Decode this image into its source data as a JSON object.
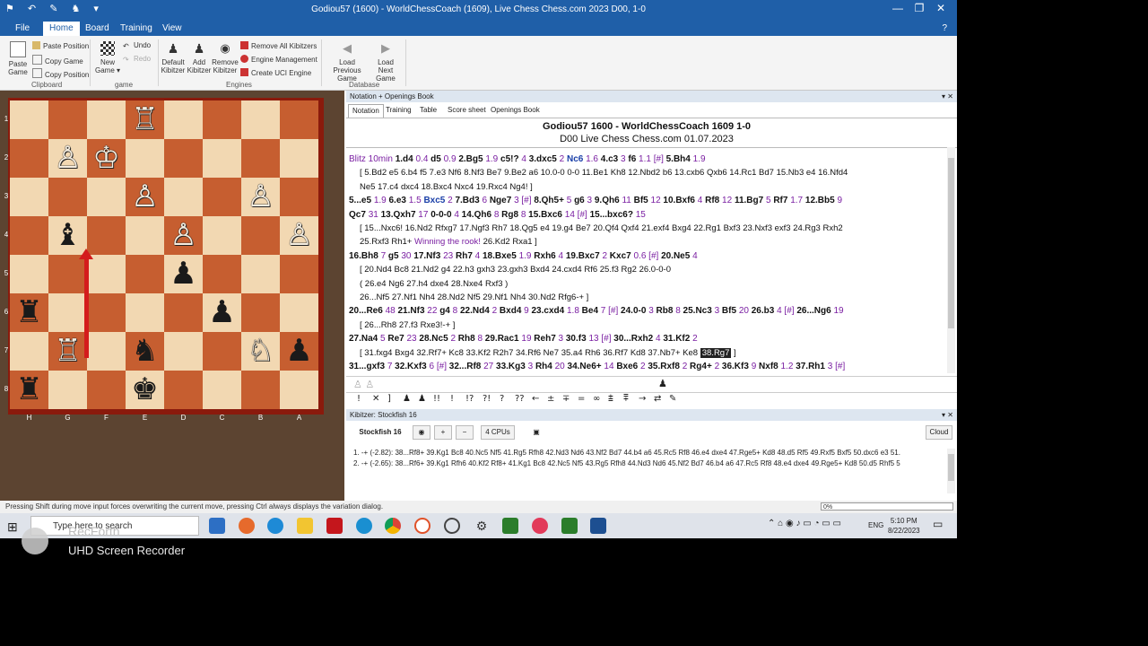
{
  "window": {
    "title": "Godiou57 (1600) - WorldChessCoach (1609), Live Chess Chess.com 2023  D00, 1-0",
    "controls": [
      "—",
      "❐",
      "✕"
    ]
  },
  "ribbon": {
    "tabs": [
      "File",
      "Home",
      "Board",
      "Training",
      "View"
    ],
    "active_tab": "Home",
    "clipboard": {
      "paste_game": "Paste Game",
      "paste_position": "Paste Position",
      "copy_game": "Copy Game",
      "copy_position": "Copy Position",
      "group": "Clipboard"
    },
    "game": {
      "new_game": "New Game ▾",
      "undo": "Undo",
      "redo": "Redo",
      "group": "game"
    },
    "engines": {
      "default_kibitzer": "Default Kibitzer",
      "add_kibitzer": "Add Kibitzer",
      "remove_kibitzer": "Remove Kibitzer",
      "remove_all": "Remove All Kibitzers",
      "engine_mgmt": "Engine Management",
      "create_uci": "Create UCI Engine",
      "group": "Engines"
    },
    "database": {
      "load_prev": "Load Previous Game",
      "load_next": "Load Next Game",
      "group": "Database"
    }
  },
  "board": {
    "ranks": [
      "1",
      "2",
      "3",
      "4",
      "5",
      "6",
      "7",
      "8"
    ],
    "files": [
      "H",
      "G",
      "F",
      "E",
      "D",
      "C",
      "B",
      "A"
    ],
    "pieces": [
      {
        "sq": "e1",
        "glyph": "♖",
        "color": "w"
      },
      {
        "sq": "g2",
        "glyph": "♙",
        "color": "w"
      },
      {
        "sq": "f2",
        "glyph": "♔",
        "color": "w"
      },
      {
        "sq": "e3",
        "glyph": "♙",
        "color": "w"
      },
      {
        "sq": "b3",
        "glyph": "♙",
        "color": "w"
      },
      {
        "sq": "g4",
        "glyph": "♝",
        "color": "b"
      },
      {
        "sq": "d4",
        "glyph": "♙",
        "color": "w"
      },
      {
        "sq": "a4",
        "glyph": "♙",
        "color": "w"
      },
      {
        "sq": "d5",
        "glyph": "♟",
        "color": "b"
      },
      {
        "sq": "h6",
        "glyph": "♜",
        "color": "b"
      },
      {
        "sq": "c6",
        "glyph": "♟",
        "color": "b"
      },
      {
        "sq": "g7",
        "glyph": "♖",
        "color": "w"
      },
      {
        "sq": "e7",
        "glyph": "♞",
        "color": "b"
      },
      {
        "sq": "b7",
        "glyph": "♘",
        "color": "w"
      },
      {
        "sq": "a7",
        "glyph": "♟",
        "color": "b"
      },
      {
        "sq": "h8",
        "glyph": "♜",
        "color": "b"
      },
      {
        "sq": "e8",
        "glyph": "♚",
        "color": "b"
      }
    ]
  },
  "notation_panel": {
    "header": "Notation + Openings Book",
    "tabs": [
      "Notation",
      "Training",
      "Table",
      "Score sheet",
      "Openings Book"
    ],
    "game_line1": "Godiou57 1600 - WorldChessCoach 1609  1-0",
    "game_line2": "D00 Live Chess Chess.com 01.07.2023",
    "lines": [
      {
        "type": "main",
        "segs": [
          [
            "vs",
            "Blitz 10min "
          ],
          [
            "mv",
            "1.d4 "
          ],
          [
            "vs",
            "0.4 "
          ],
          [
            "mv",
            "d5 "
          ],
          [
            "vs",
            "0.9 "
          ],
          [
            "mv",
            "2.Bg5 "
          ],
          [
            "vs",
            "1.9 "
          ],
          [
            "mv",
            "c5!? "
          ],
          [
            "vs",
            "4 "
          ],
          [
            "mv",
            "3.dxc5 "
          ],
          [
            "vs",
            "2 "
          ],
          [
            "hl",
            "Nc6 "
          ],
          [
            "vs",
            "1.6 "
          ],
          [
            "mv",
            "4.c3 "
          ],
          [
            "vs",
            "3 "
          ],
          [
            "mv",
            "f6 "
          ],
          [
            "vs",
            "1.1 [#] "
          ],
          [
            "mv",
            "5.Bh4 "
          ],
          [
            "vs",
            "1.9"
          ]
        ]
      },
      {
        "type": "var",
        "segs": [
          [
            "t",
            "[ 5.Bd2 e5 6.b4 f5 7.e3 Nf6 8.Nf3 Be7 9.Be2 a6 10.0-0 0-0 11.Be1 Kh8 12.Nbd2 b6 13.cxb6 Qxb6 14.Rc1 Bd7 15.Nb3 e4 16.Nfd4"
          ]
        ]
      },
      {
        "type": "var",
        "segs": [
          [
            "t",
            "Ne5 17.c4 dxc4 18.Bxc4 Nxc4 19.Rxc4 Ng4! ]"
          ]
        ]
      },
      {
        "type": "main",
        "segs": [
          [
            "mv",
            "5...e5 "
          ],
          [
            "vs",
            "1.9 "
          ],
          [
            "mv",
            "6.e3 "
          ],
          [
            "vs",
            "1.5 "
          ],
          [
            "hl",
            "Bxc5 "
          ],
          [
            "vs",
            "2 "
          ],
          [
            "mv",
            "7.Bd3 "
          ],
          [
            "vs",
            "6 "
          ],
          [
            "mv",
            "Nge7 "
          ],
          [
            "vs",
            "3 [#] "
          ],
          [
            "mv",
            "8.Qh5+ "
          ],
          [
            "vs",
            "5 "
          ],
          [
            "mv",
            "g6 "
          ],
          [
            "vs",
            "3 "
          ],
          [
            "mv",
            "9.Qh6 "
          ],
          [
            "vs",
            "11 "
          ],
          [
            "mv",
            "Bf5 "
          ],
          [
            "vs",
            "12 "
          ],
          [
            "mv",
            "10.Bxf6 "
          ],
          [
            "vs",
            "4 "
          ],
          [
            "mv",
            "Rf8 "
          ],
          [
            "vs",
            "12 "
          ],
          [
            "mv",
            "11.Bg7 "
          ],
          [
            "vs",
            "5 "
          ],
          [
            "mv",
            "Rf7 "
          ],
          [
            "vs",
            "1.7 "
          ],
          [
            "mv",
            "12.Bb5 "
          ],
          [
            "vs",
            "9"
          ]
        ]
      },
      {
        "type": "main",
        "segs": [
          [
            "mv",
            "Qc7 "
          ],
          [
            "vs",
            "31 "
          ],
          [
            "mv",
            "13.Qxh7 "
          ],
          [
            "vs",
            "17 "
          ],
          [
            "mv",
            "0-0-0 "
          ],
          [
            "vs",
            "4 "
          ],
          [
            "mv",
            "14.Qh6 "
          ],
          [
            "vs",
            "8 "
          ],
          [
            "mv",
            "Rg8 "
          ],
          [
            "vs",
            "8 "
          ],
          [
            "mv",
            "15.Bxc6 "
          ],
          [
            "vs",
            "14 [#] "
          ],
          [
            "mv",
            "15...bxc6? "
          ],
          [
            "vs",
            "15"
          ]
        ]
      },
      {
        "type": "var",
        "segs": [
          [
            "t",
            "[ 15...Nxc6! 16.Nd2 Rfxg7 17.Ngf3 Rh7 18.Qg5 e4 19.g4 Be7 20.Qf4 Qxf4 21.exf4 Bxg4 22.Rg1 Bxf3 23.Nxf3 exf3 24.Rg3 Rxh2"
          ]
        ]
      },
      {
        "type": "var",
        "segs": [
          [
            "t",
            "25.Rxf3 Rh1+ "
          ],
          [
            "vs",
            "Winning the rook! "
          ],
          [
            "t",
            "26.Kd2 Rxa1 ]"
          ]
        ]
      },
      {
        "type": "main",
        "segs": [
          [
            "mv",
            "16.Bh8 "
          ],
          [
            "vs",
            "7 "
          ],
          [
            "mv",
            "g5 "
          ],
          [
            "vs",
            "30 "
          ],
          [
            "mv",
            "17.Nf3 "
          ],
          [
            "vs",
            "23 "
          ],
          [
            "mv",
            "Rh7 "
          ],
          [
            "vs",
            "4 "
          ],
          [
            "mv",
            "18.Bxe5 "
          ],
          [
            "vs",
            "1.9 "
          ],
          [
            "mv",
            "Rxh6 "
          ],
          [
            "vs",
            "4 "
          ],
          [
            "mv",
            "19.Bxc7 "
          ],
          [
            "vs",
            "2 "
          ],
          [
            "mv",
            "Kxc7 "
          ],
          [
            "vs",
            "0.6 [#] "
          ],
          [
            "mv",
            "20.Ne5 "
          ],
          [
            "vs",
            "4"
          ]
        ]
      },
      {
        "type": "var",
        "segs": [
          [
            "t",
            "[ 20.Nd4 Bc8 21.Nd2 g4 22.h3 gxh3 23.gxh3 Bxd4 24.cxd4 Rf6 25.f3 Rg2 26.0-0-0"
          ]
        ]
      },
      {
        "type": "var",
        "segs": [
          [
            "t",
            "   ( 26.e4 Ng6 27.h4 dxe4 28.Nxe4 Rxf3 )"
          ]
        ]
      },
      {
        "type": "var",
        "segs": [
          [
            "t",
            "26...Nf5 27.Nf1 Nh4 28.Nd2 Nf5 29.Nf1 Nh4 30.Nd2 Rfg6-+ ]"
          ]
        ]
      },
      {
        "type": "main",
        "segs": [
          [
            "mv",
            "20...Re6 "
          ],
          [
            "vs",
            "48 "
          ],
          [
            "mv",
            "21.Nf3 "
          ],
          [
            "vs",
            "22 "
          ],
          [
            "mv",
            "g4 "
          ],
          [
            "vs",
            "8 "
          ],
          [
            "mv",
            "22.Nd4 "
          ],
          [
            "vs",
            "2 "
          ],
          [
            "mv",
            "Bxd4 "
          ],
          [
            "vs",
            "9 "
          ],
          [
            "mv",
            "23.cxd4 "
          ],
          [
            "vs",
            "1.8 "
          ],
          [
            "mv",
            "Be4 "
          ],
          [
            "vs",
            "7 [#] "
          ],
          [
            "mv",
            "24.0-0 "
          ],
          [
            "vs",
            "3 "
          ],
          [
            "mv",
            "Rb8 "
          ],
          [
            "vs",
            "8 "
          ],
          [
            "mv",
            "25.Nc3 "
          ],
          [
            "vs",
            "3 "
          ],
          [
            "mv",
            "Bf5 "
          ],
          [
            "vs",
            "20 "
          ],
          [
            "mv",
            "26.b3 "
          ],
          [
            "vs",
            "4 [#] "
          ],
          [
            "mv",
            "26...Ng6 "
          ],
          [
            "vs",
            "19"
          ]
        ]
      },
      {
        "type": "var",
        "segs": [
          [
            "t",
            "[ 26...Rh8 27.f3 Rxe3!-+ ]"
          ]
        ]
      },
      {
        "type": "main",
        "segs": [
          [
            "mv",
            "27.Na4 "
          ],
          [
            "vs",
            "5 "
          ],
          [
            "mv",
            "Re7 "
          ],
          [
            "vs",
            "23 "
          ],
          [
            "mv",
            "28.Nc5 "
          ],
          [
            "vs",
            "2 "
          ],
          [
            "mv",
            "Rh8 "
          ],
          [
            "vs",
            "8 "
          ],
          [
            "mv",
            "29.Rac1 "
          ],
          [
            "vs",
            "19 "
          ],
          [
            "mv",
            "Reh7 "
          ],
          [
            "vs",
            "3 "
          ],
          [
            "mv",
            "30.f3 "
          ],
          [
            "vs",
            "13 [#] "
          ],
          [
            "mv",
            "30...Rxh2 "
          ],
          [
            "vs",
            "4 "
          ],
          [
            "mv",
            "31.Kf2 "
          ],
          [
            "vs",
            "2"
          ]
        ]
      },
      {
        "type": "var",
        "segs": [
          [
            "t",
            "[ 31.fxg4 Bxg4 32.Rf7+ Kc8 33.Kf2 R2h7 34.Rf6 Ne7 35.a4 Rh6 36.Rf7 Kd8 37.Nb7+ Ke8 "
          ],
          [
            "sel",
            "38.Rg7"
          ],
          [
            "t",
            " ]"
          ]
        ]
      },
      {
        "type": "main",
        "segs": [
          [
            "mv",
            "31...gxf3 "
          ],
          [
            "vs",
            "7 "
          ],
          [
            "mv",
            "32.Kxf3 "
          ],
          [
            "vs",
            "6 [#] "
          ],
          [
            "mv",
            "32...Rf8 "
          ],
          [
            "vs",
            "27 "
          ],
          [
            "mv",
            "33.Kg3 "
          ],
          [
            "vs",
            "3 "
          ],
          [
            "mv",
            "Rh4 "
          ],
          [
            "vs",
            "20 "
          ],
          [
            "mv",
            "34.Ne6+ "
          ],
          [
            "vs",
            "14 "
          ],
          [
            "mv",
            "Bxe6 "
          ],
          [
            "vs",
            "2 "
          ],
          [
            "mv",
            "35.Rxf8 "
          ],
          [
            "vs",
            "2 "
          ],
          [
            "mv",
            "Rg4+ "
          ],
          [
            "vs",
            "2 "
          ],
          [
            "mv",
            "36.Kf3 "
          ],
          [
            "vs",
            "9 "
          ],
          [
            "mv",
            "Nxf8 "
          ],
          [
            "vs",
            "1.2 "
          ],
          [
            "mv",
            "37.Rh1 "
          ],
          [
            "vs",
            "3 [#]"
          ]
        ]
      }
    ],
    "symbols": [
      "!",
      "✕",
      "]",
      "♟",
      "♟",
      "!!",
      "!",
      "!?",
      "?!",
      "?",
      "??",
      "←",
      "±",
      "∓",
      "=",
      "∞",
      "⩲",
      "⩱",
      "→",
      "⇄",
      "✎"
    ]
  },
  "kibitzer": {
    "header": "Kibitzer: Stockfish 16",
    "engine": "Stockfish 16",
    "cpus": "4 CPUs",
    "cloud": "Cloud",
    "lines": [
      "1. -+ (-2.82): 38...Rf8+ 39.Kg1 Bc8 40.Nc5 Nf5 41.Rg5 Rfh8 42.Nd3 Nd6 43.Nf2 Bd7 44.b4 a6 45.Rc5 Rf8 46.e4 dxe4 47.Rge5+ Kd8 48.d5 Rf5 49.Rxf5 Bxf5 50.dxc6 e3 51.",
      "2. -+ (-2.65): 38...Rf6+ 39.Kg1 Rfh6 40.Kf2 Rf8+ 41.Kg1 Bc8 42.Nc5 Nf5 43.Rg5 Rfh8 44.Nd3 Nd6 45.Nf2 Bd7 46.b4 a6 47.Rc5 Rf8 48.e4 dxe4 49.Rge5+ Kd8 50.d5 Rhf5 5"
    ]
  },
  "statusbar": {
    "message": "Pressing Shift during move input forces overwriting the current move, pressing Ctrl always displays the variation dialog.",
    "progress": "0%"
  },
  "taskbar": {
    "search_placeholder": "Type here to search",
    "lang": "ENG",
    "time": "5:10 PM",
    "date": "8/22/2023"
  },
  "watermark": {
    "brand": "RecForth",
    "product": "UHD Screen Recorder"
  }
}
